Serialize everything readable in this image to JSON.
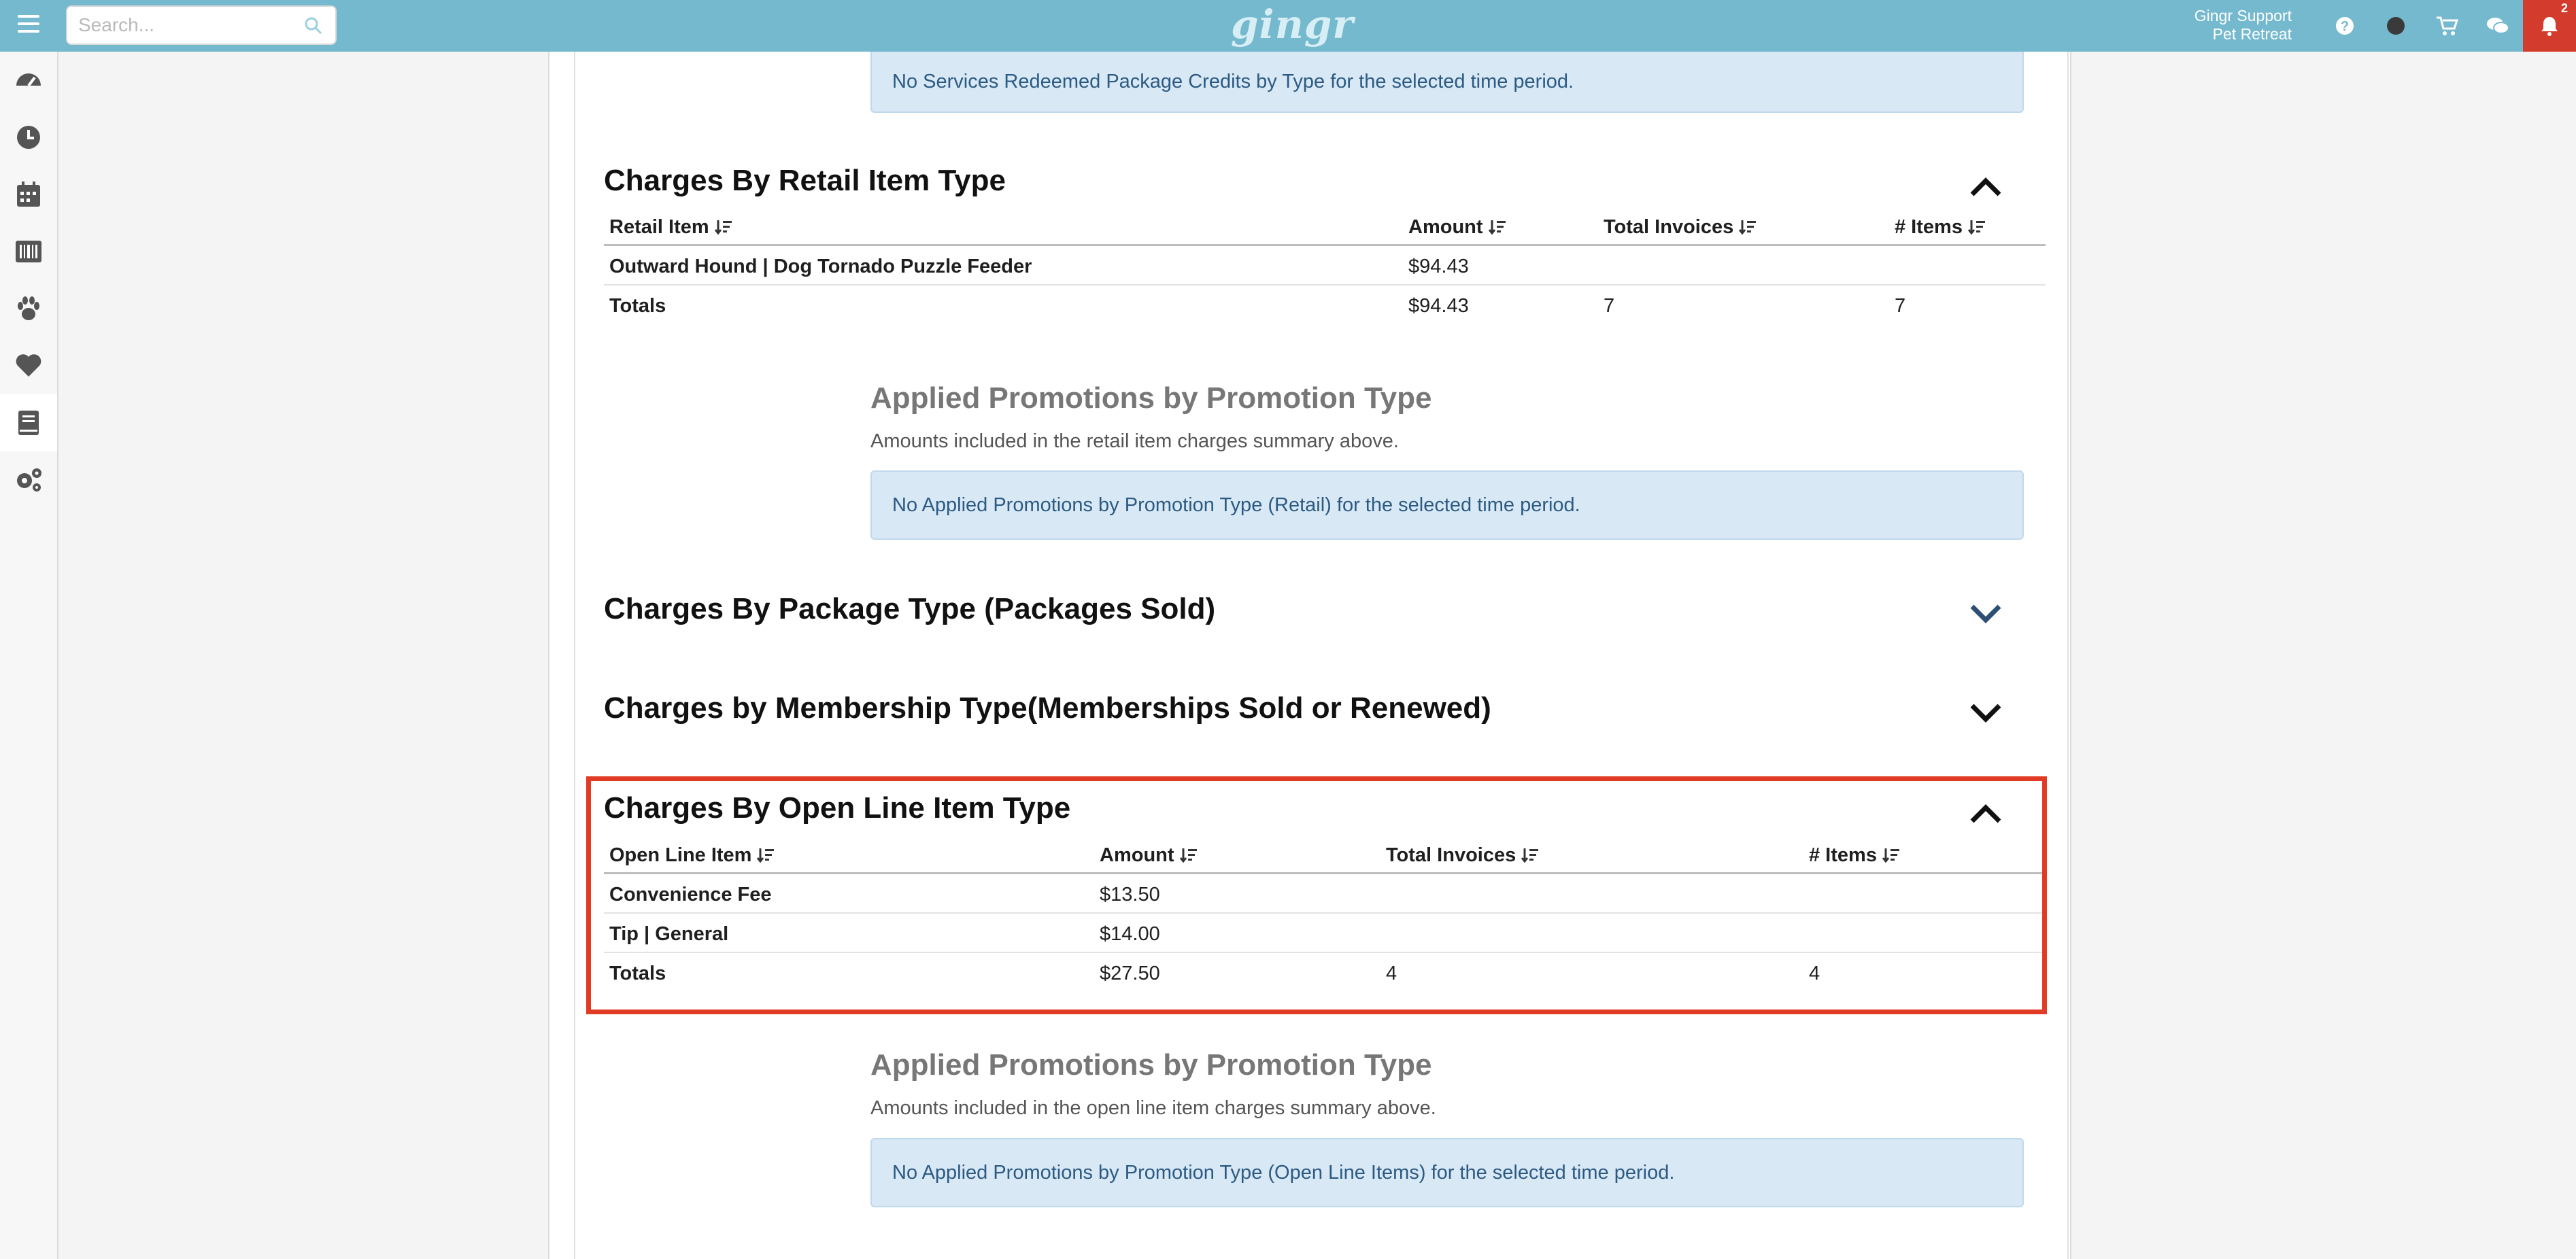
{
  "topbar": {
    "search_placeholder": "Search...",
    "logo": "gingr",
    "user_name": "Gingr Support",
    "user_location": "Pet Retreat",
    "notification_count": "2"
  },
  "sidebar": {
    "items": [
      "dashboard",
      "history",
      "calendar",
      "pricing",
      "pets",
      "favorites",
      "reports",
      "settings"
    ],
    "active": "reports"
  },
  "banner_top": "No Services Redeemed Package Credits by Type for the selected time period.",
  "retail": {
    "title": "Charges By Retail Item Type",
    "headers": {
      "item": "Retail Item",
      "amount": "Amount",
      "invoices": "Total Invoices",
      "items": "# Items"
    },
    "rows": [
      {
        "item": "Outward Hound | Dog Tornado Puzzle Feeder",
        "amount": "$94.43",
        "invoices": "",
        "items": ""
      }
    ],
    "totals": {
      "label": "Totals",
      "amount": "$94.43",
      "invoices": "7",
      "items": "7"
    },
    "promo_title": "Applied Promotions by Promotion Type",
    "promo_sub": "Amounts included in the retail item charges summary above.",
    "promo_alert": "No Applied Promotions by Promotion Type (Retail) for the selected time period."
  },
  "package": {
    "title": "Charges By Package Type (Packages Sold)"
  },
  "membership": {
    "title": "Charges by Membership Type(Memberships Sold or Renewed)"
  },
  "openline": {
    "title": "Charges By Open Line Item Type",
    "headers": {
      "item": "Open Line Item",
      "amount": "Amount",
      "invoices": "Total Invoices",
      "items": "# Items"
    },
    "rows": [
      {
        "item": "Convenience Fee",
        "amount": "$13.50"
      },
      {
        "item": "Tip | General",
        "amount": "$14.00"
      }
    ],
    "totals": {
      "label": "Totals",
      "amount": "$27.50",
      "invoices": "4",
      "items": "4"
    },
    "promo_title": "Applied Promotions by Promotion Type",
    "promo_sub": "Amounts included in the open line item charges summary above.",
    "promo_alert": "No Applied Promotions by Promotion Type (Open Line Items) for the selected time period."
  },
  "colors": {
    "topbar": "#75b9cf",
    "alert_bg": "#d9e8f5",
    "highlight": "#e23b25",
    "bell": "#d33b2c"
  }
}
